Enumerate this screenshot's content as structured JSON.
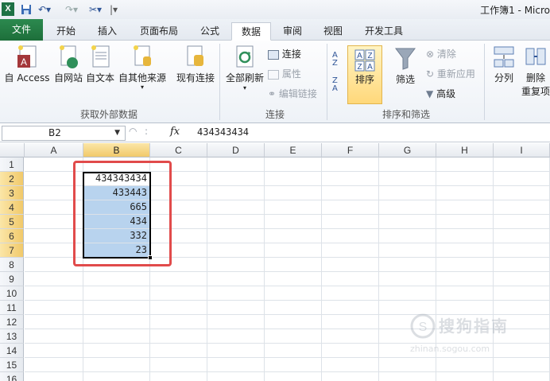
{
  "window": {
    "title": "工作簿1 - Micro"
  },
  "tabs": [
    {
      "label": "文件",
      "active": false
    },
    {
      "label": "开始",
      "active": false
    },
    {
      "label": "插入",
      "active": false
    },
    {
      "label": "页面布局",
      "active": false
    },
    {
      "label": "公式",
      "active": false
    },
    {
      "label": "数据",
      "active": true
    },
    {
      "label": "审阅",
      "active": false
    },
    {
      "label": "视图",
      "active": false
    },
    {
      "label": "开发工具",
      "active": false
    }
  ],
  "ribbon": {
    "get_external": {
      "label": "获取外部数据",
      "buttons": [
        "自 Access",
        "自网站",
        "自文本",
        "自其他来源",
        "现有连接"
      ]
    },
    "connections": {
      "label": "连接",
      "refresh_all": "全部刷新",
      "items": [
        "连接",
        "属性",
        "编辑链接"
      ]
    },
    "sort_filter": {
      "label": "排序和筛选",
      "sort": "排序",
      "filter": "筛选",
      "items": [
        "清除",
        "重新应用",
        "高级"
      ]
    },
    "data_tools": {
      "buttons": [
        "分列",
        "删除",
        "重复项"
      ]
    }
  },
  "formula_bar": {
    "name_box": "B2",
    "fx": "fx",
    "value": "434343434"
  },
  "sheet": {
    "columns": [
      "A",
      "B",
      "C",
      "D",
      "E",
      "F",
      "G",
      "H",
      "I"
    ],
    "selected_column": "B",
    "rows": [
      "1",
      "2",
      "3",
      "4",
      "5",
      "6",
      "7",
      "8",
      "9",
      "10",
      "11",
      "12",
      "13",
      "14",
      "15",
      "16"
    ],
    "selected_rows": [
      "2",
      "3",
      "4",
      "5",
      "6",
      "7"
    ],
    "b_values": [
      "434343434",
      "433443",
      "665",
      "434",
      "332",
      "23"
    ]
  },
  "watermark": {
    "text": "搜狗指南",
    "url": "zhinan.sogou.com"
  },
  "colors": {
    "file_tab": "#1e7145",
    "selection_fill": "#b8d3ee",
    "highlight_box": "#e14b4b",
    "sort_active": "#ffd87a"
  }
}
